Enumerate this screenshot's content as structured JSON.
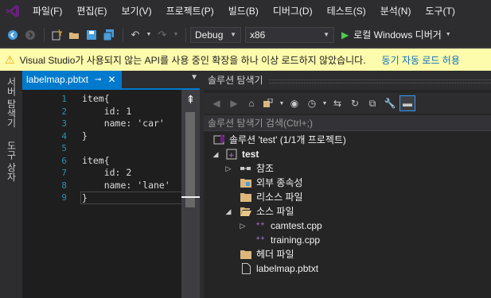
{
  "menu": [
    "파일(F)",
    "편집(E)",
    "보기(V)",
    "프로젝트(P)",
    "빌드(B)",
    "디버그(D)",
    "테스트(S)",
    "분석(N)",
    "도구(T)"
  ],
  "toolbar": {
    "config": "Debug",
    "platform": "x86",
    "run_label": "로컬 Windows 디버거"
  },
  "infobar": {
    "message": "Visual Studio가 사용되지 않는 API를 사용 중인 확장을 하나 이상 로드하지 않았습니다.",
    "link": "동기 자동 로드 허용"
  },
  "left_tabs": [
    "서버 탐색기",
    "도구 상자"
  ],
  "editor": {
    "tab_title": "labelmap.pbtxt",
    "lines": [
      "item{",
      "    id: 1",
      "    name: 'car'",
      "}",
      "",
      "item{",
      "    id: 2",
      "    name: 'lane'",
      "}"
    ],
    "line_numbers": [
      "1",
      "2",
      "3",
      "4",
      "5",
      "6",
      "7",
      "8",
      "9"
    ]
  },
  "solution_explorer": {
    "title": "솔루션 탐색기",
    "search_placeholder": "솔루션 탐색기 검색(Ctrl+;)",
    "tree": [
      {
        "label": "솔루션 'test' (1/1개 프로젝트)",
        "icon": "solution-icon"
      },
      {
        "label": "test",
        "icon": "project-icon"
      },
      {
        "label": "참조",
        "icon": "references-icon"
      },
      {
        "label": "외부 종속성",
        "icon": "folder-icon"
      },
      {
        "label": "리소스 파일",
        "icon": "folder-icon"
      },
      {
        "label": "소스 파일",
        "icon": "folder-open-icon"
      },
      {
        "label": "camtest.cpp",
        "icon": "cpp-file-icon"
      },
      {
        "label": "training.cpp",
        "icon": "cpp-file-icon"
      },
      {
        "label": "헤더 파일",
        "icon": "folder-icon"
      },
      {
        "label": "labelmap.pbtxt",
        "icon": "text-file-icon"
      }
    ]
  },
  "colors": {
    "accent": "#007acc",
    "infobar": "#fdfbac",
    "line_number": "#2b91af",
    "folder": "#dcb67a",
    "cpp": "#b180d7"
  }
}
